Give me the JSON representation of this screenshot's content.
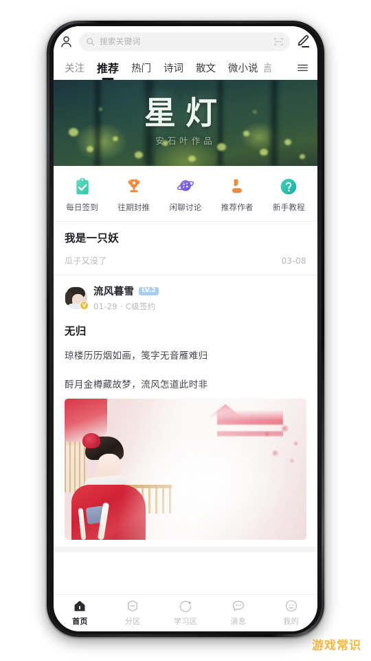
{
  "app": {
    "topbar": {
      "profile_icon": "person-icon",
      "search_placeholder": "搜索关键词",
      "search_value": "",
      "search_icon": "search-icon",
      "scan_icon": "scan-icon",
      "compose_icon": "pencil-edit-icon"
    },
    "tabs": {
      "items": [
        {
          "label": "关注",
          "active": false
        },
        {
          "label": "推荐",
          "active": true
        },
        {
          "label": "热门",
          "active": false
        },
        {
          "label": "诗词",
          "active": false
        },
        {
          "label": "散文",
          "active": false
        },
        {
          "label": "微小说",
          "active": false
        },
        {
          "label": "言",
          "active": false
        }
      ],
      "more_icon": "hamburger-menu-icon"
    },
    "banner": {
      "title": "星灯",
      "subtitle": "安石叶作品"
    },
    "quick_actions": [
      {
        "label": "每日签到",
        "icon": "clipboard-check-icon",
        "color": "#4fd1b4"
      },
      {
        "label": "往期封推",
        "icon": "trophy-icon",
        "color": "#f08a3c"
      },
      {
        "label": "闲聊讨论",
        "icon": "planet-icon",
        "color": "#7a63e0"
      },
      {
        "label": "推荐作者",
        "icon": "person-filled-icon",
        "color": "#f08a3c"
      },
      {
        "label": "新手教程",
        "icon": "question-circle-icon",
        "color": "#2ec4b0"
      }
    ],
    "feed": [
      {
        "type": "simple",
        "title": "我是一只妖",
        "author": "瓜子又没了",
        "date": "03-08"
      },
      {
        "type": "rich",
        "user": {
          "name": "流风暮雪",
          "level_badge": "LV.2",
          "verified_badge": "V",
          "avatar": "user-avatar"
        },
        "meta": "01-29 · C级签约",
        "title": "无归",
        "lines": [
          "琼楼历历烟如画，笺字无音雁难归",
          "酹月金樽藏故梦，流风怎道此时非"
        ],
        "image_alt": "传统中国风插画"
      }
    ],
    "bottom_nav": [
      {
        "label": "首页",
        "icon": "home-icon",
        "active": true
      },
      {
        "label": "分区",
        "icon": "hexagon-minus-icon",
        "active": false
      },
      {
        "label": "学习区",
        "icon": "circle-arrow-icon",
        "active": false
      },
      {
        "label": "消息",
        "icon": "chat-bubble-icon",
        "active": false
      },
      {
        "label": "我的",
        "icon": "face-circle-icon",
        "active": false
      }
    ],
    "watermark": "游戏常识",
    "colors": {
      "accent_dark": "#1b1d21",
      "level_badge": "#a9cdf0",
      "verified": "#f5b929",
      "watermark": "#f5b63c",
      "muted_text": "#b6b8bd"
    }
  }
}
